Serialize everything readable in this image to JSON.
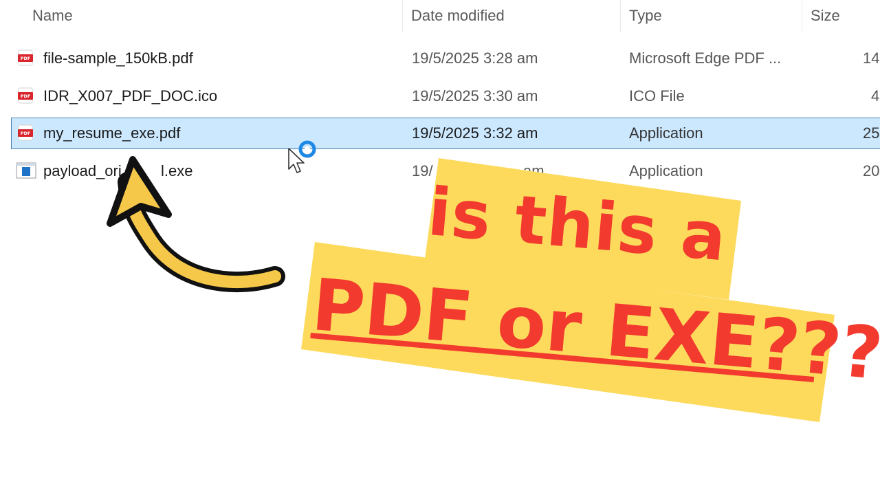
{
  "columns": {
    "name": "Name",
    "date_modified": "Date modified",
    "type": "Type",
    "size": "Size"
  },
  "files": [
    {
      "name": "file-sample_150kB.pdf",
      "date": "19/5/2025 3:28 am",
      "type": "Microsoft Edge PDF ...",
      "size": "14",
      "icon": "pdf-file-icon",
      "selected": false
    },
    {
      "name": "IDR_X007_PDF_DOC.ico",
      "date": "19/5/2025 3:30 am",
      "type": "ICO File",
      "size": "4",
      "icon": "pdf-file-icon",
      "selected": false
    },
    {
      "name": "my_resume_exe.pdf",
      "date": "19/5/2025 3:32 am",
      "type": "Application",
      "size": "25",
      "icon": "pdf-file-icon",
      "selected": true
    },
    {
      "name": "payload_ori",
      "name_tail": "l.exe",
      "date": "19/",
      "date_tail": "am",
      "type": "Application",
      "size": "20",
      "icon": "exe-file-icon",
      "selected": false
    }
  ],
  "overlay": {
    "line1": "is this a",
    "line2": "PDF or EXE???",
    "banner_color": "#fdda5c",
    "text_color": "#f23a2e",
    "arrow_color": "#f6c84a"
  },
  "colors": {
    "selection": "#cce8ff",
    "selection_border": "#4a7fb0",
    "pdf_red": "#d9252c",
    "exe_blue": "#1e72c8"
  }
}
